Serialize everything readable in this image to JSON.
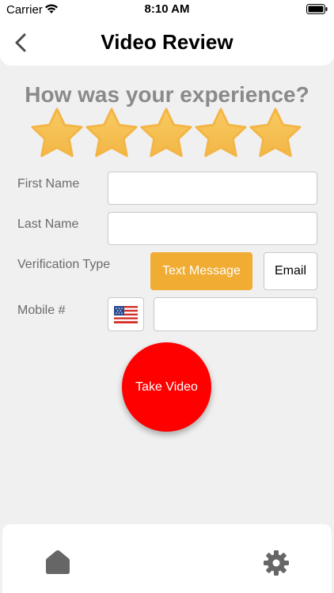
{
  "status_bar": {
    "carrier": "Carrier",
    "time": "8:10 AM",
    "icons": [
      "wifi-icon",
      "battery-icon"
    ]
  },
  "header": {
    "back_icon": "chevron-left-icon",
    "title": "Video Review"
  },
  "rating": {
    "question": "How was your experience?",
    "max_stars": 5,
    "selected_stars": 5,
    "star_color": "#f5b941"
  },
  "form": {
    "first_name": {
      "label": "First Name",
      "value": ""
    },
    "last_name": {
      "label": "Last Name",
      "value": ""
    },
    "verification": {
      "label": "Verification Type",
      "options": [
        "Text Message",
        "Email"
      ],
      "selected": "Text Message"
    },
    "mobile": {
      "label": "Mobile #",
      "country_flag": "flag-us-icon",
      "value": ""
    }
  },
  "take_video": {
    "label": "Take Video",
    "color": "#ff0000"
  },
  "tab_bar": {
    "items": [
      "home-icon",
      "gear-icon"
    ]
  },
  "colors": {
    "accent": "#f0ac33",
    "background": "#f0f0f0",
    "muted_text": "#8a8a8a"
  }
}
